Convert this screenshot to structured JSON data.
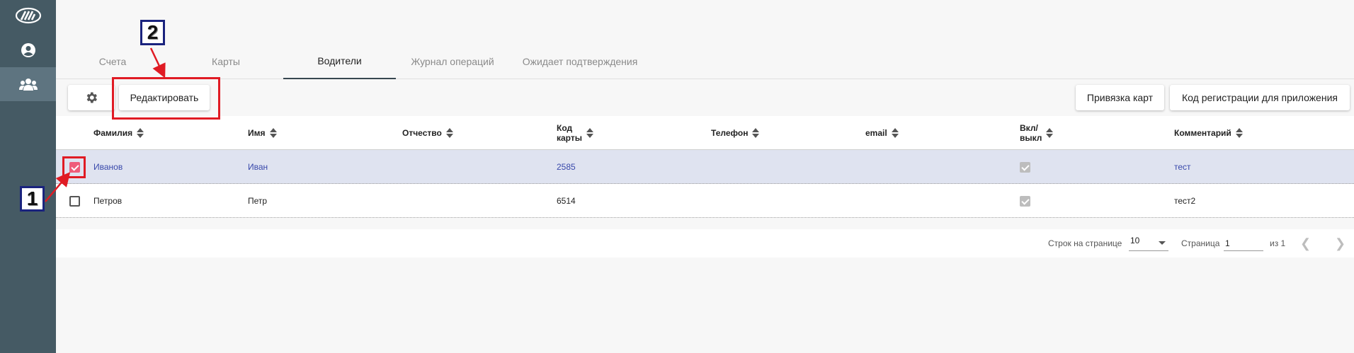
{
  "sidebar": {
    "items": [
      {
        "name": "logo"
      },
      {
        "name": "account"
      },
      {
        "name": "drivers",
        "active": true
      }
    ]
  },
  "tabs": [
    {
      "label": "Счета"
    },
    {
      "label": "Карты"
    },
    {
      "label": "Водители",
      "active": true
    },
    {
      "label": "Журнал операций"
    },
    {
      "label": "Ожидает подтверждения"
    }
  ],
  "toolbar": {
    "edit_label": "Редактировать",
    "bind_cards_label": "Привязка карт",
    "registration_code_label": "Код регистрации для приложения"
  },
  "table": {
    "columns": [
      "Фамилия",
      "Имя",
      "Отчество",
      "Код\nкарты",
      "Телефон",
      "email",
      "Вкл/\nвыкл",
      "Комментарий"
    ],
    "rows": [
      {
        "selected": true,
        "last_name": "Иванов",
        "first_name": "Иван",
        "patronymic": "",
        "card_code": "2585",
        "phone": "",
        "email": "",
        "enabled": true,
        "comment": "тест"
      },
      {
        "selected": false,
        "last_name": "Петров",
        "first_name": "Петр",
        "patronymic": "",
        "card_code": "6514",
        "phone": "",
        "email": "",
        "enabled": true,
        "comment": "тест2"
      }
    ]
  },
  "pagination": {
    "rows_per_page_label": "Строк на странице",
    "rows_per_page": "10",
    "page_label": "Страница",
    "page": "1",
    "of_label": "из 1"
  },
  "annotations": {
    "callout1": "1",
    "callout2": "2"
  },
  "colors": {
    "sidebar": "#455a64",
    "selected_row": "#dfe3f0",
    "accent_text": "#3949ab",
    "highlight": "#e01b24",
    "checkbox_on": "#ef5c7a"
  }
}
